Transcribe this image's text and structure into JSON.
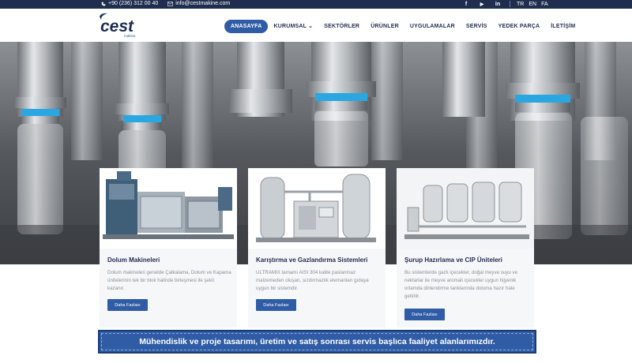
{
  "topbar": {
    "phone": "+90 (236) 312 00 40",
    "email": "info@cestmakine.com",
    "social": [
      {
        "icon": "facebook-icon",
        "glyph": "f"
      },
      {
        "icon": "youtube-icon",
        "glyph": "▶"
      },
      {
        "icon": "linkedin-icon",
        "glyph": "in"
      }
    ],
    "languages": [
      "TR",
      "EN",
      "FA"
    ]
  },
  "logo": {
    "text": "cest",
    "subtext": "makine"
  },
  "nav": {
    "items": [
      {
        "label": "ANASAYFA",
        "active": true
      },
      {
        "label": "KURUMSAL ⌄",
        "active": false
      },
      {
        "label": "SEKTÖRLER",
        "active": false
      },
      {
        "label": "ÜRÜNLER",
        "active": false
      },
      {
        "label": "UYGULAMALAR",
        "active": false
      },
      {
        "label": "SERVİS",
        "active": false
      },
      {
        "label": "YEDEK PARÇA",
        "active": false
      },
      {
        "label": "İLETİŞİM",
        "active": false
      }
    ]
  },
  "cards": [
    {
      "title": "Dolum Makineleri",
      "text": "Dolum makineleri genelde Çalkalama, Dolum ve Kapama ünitelerinin tek bir blok halinde birleşmesi ile şekil kazanır.",
      "button": "Daha Fazlası"
    },
    {
      "title": "Karıştırma ve Gazlandırma Sistemleri",
      "text": "ULTRAMIX tamamı AISI 304 kalite paslanmaz malzemeden oluşan, sızdırmazlık elemanları gıdaya uygun bir sistemdir.",
      "button": "Daha Fazlası"
    },
    {
      "title": "Şurup Hazırlama ve CIP Üniteleri",
      "text": "Bu sistemlerde gazlı içecekler, doğal meyve suyu ve nektarlar ile meyve aromalı içecekler uygun hijyenik ortamda dinlendirme tanklarında doluma hazır hale getirilir.",
      "button": "Daha Fazlası"
    }
  ],
  "banner": {
    "text": "Mühendislik ve proje tasarımı, üretim ve satış sonrası servis başlıca faaliyet alanlarımızdır."
  },
  "colors": {
    "navy": "#1f2d4f",
    "accent": "#2f5ca5"
  }
}
